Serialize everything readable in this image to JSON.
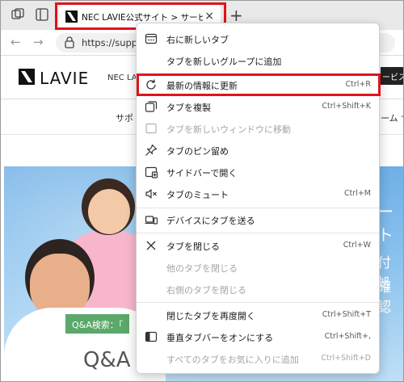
{
  "tab": {
    "title": "NEC LAVIE公式サイト > サービス＆サ",
    "close": "×",
    "new_tab": "+"
  },
  "address": {
    "url": "https://suppo"
  },
  "page": {
    "logo": "LAVIE",
    "nec": "NEC LA",
    "header_right": "ービス",
    "subnav_left": "サポ",
    "subnav_right": "ーム サ",
    "hero_right_1": "ート",
    "hero_right_2": "付処",
    "hero_right_3": "確認",
    "qa_badge": "Q&A検索：「",
    "qa_big": "Q&A"
  },
  "menu": {
    "items": [
      {
        "label": "右に新しいタブ",
        "shortcut": "",
        "icon": "new-tab-right-icon",
        "disabled": false
      },
      {
        "label": "タブを新しいグループに追加",
        "shortcut": "",
        "icon": "",
        "disabled": false
      },
      {
        "label": "最新の情報に更新",
        "shortcut": "Ctrl+R",
        "icon": "refresh-icon",
        "disabled": false
      },
      {
        "label": "タブを複製",
        "shortcut": "Ctrl+Shift+K",
        "icon": "duplicate-icon",
        "disabled": false
      },
      {
        "label": "タブを新しいウィンドウに移動",
        "shortcut": "",
        "icon": "move-window-icon",
        "disabled": true
      },
      {
        "label": "タブのピン留め",
        "shortcut": "",
        "icon": "pin-icon",
        "disabled": false
      },
      {
        "label": "サイドバーで開く",
        "shortcut": "",
        "icon": "sidebar-icon",
        "disabled": false
      },
      {
        "label": "タブのミュート",
        "shortcut": "Ctrl+M",
        "icon": "mute-icon",
        "disabled": false
      },
      {
        "label": "デバイスにタブを送る",
        "shortcut": "",
        "icon": "send-device-icon",
        "disabled": false
      },
      {
        "label": "タブを閉じる",
        "shortcut": "Ctrl+W",
        "icon": "close-icon",
        "disabled": false
      },
      {
        "label": "他のタブを閉じる",
        "shortcut": "",
        "icon": "",
        "disabled": true
      },
      {
        "label": "右側のタブを閉じる",
        "shortcut": "",
        "icon": "",
        "disabled": true
      },
      {
        "label": "閉じたタブを再度開く",
        "shortcut": "Ctrl+Shift+T",
        "icon": "",
        "disabled": false
      },
      {
        "label": "垂直タブバーをオンにする",
        "shortcut": "Ctrl+Shift+,",
        "icon": "vertical-tabs-icon",
        "disabled": false
      },
      {
        "label": "すべてのタブをお気に入りに追加",
        "shortcut": "Ctrl+Shift+D",
        "icon": "",
        "disabled": true
      }
    ]
  },
  "colors": {
    "highlight": "#e0131b",
    "menu_bg": "#ffffff",
    "disabled_text": "#a4a4a4"
  }
}
